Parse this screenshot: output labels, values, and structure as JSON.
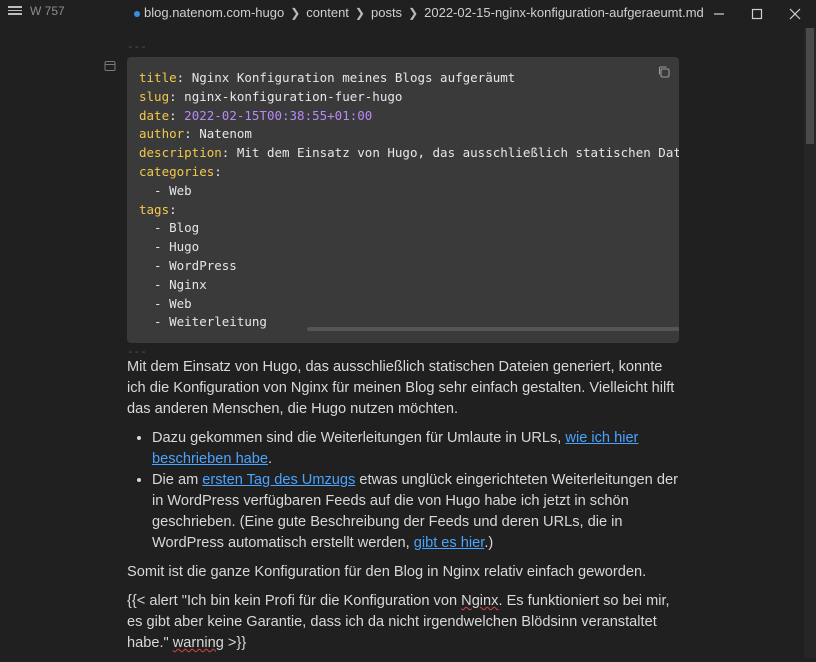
{
  "titlebar": {
    "word_count": "W 757",
    "breadcrumbs": [
      "blog.natenom.com-hugo",
      "content",
      "posts",
      "2022-02-15-nginx-konfiguration-aufgeraeumt.md"
    ]
  },
  "frontmatter": {
    "separator": "---",
    "lines": [
      {
        "key": "title",
        "value": " Nginx Konfiguration meines Blogs aufgeräumt"
      },
      {
        "key": "slug",
        "value": " nginx-konfiguration-fuer-hugo"
      },
      {
        "key": "date",
        "value": "2022-02-15T00:38:55+01:00"
      },
      {
        "key": "author",
        "value": " Natenom"
      },
      {
        "key": "description",
        "value": " Mit dem Einsatz von Hugo, das ausschließlich statischen Datei"
      },
      {
        "key": "categories",
        "value": ""
      },
      {
        "text": "  - Web"
      },
      {
        "key": "tags",
        "value": ""
      },
      {
        "text": "  - Blog"
      },
      {
        "text": "  - Hugo"
      },
      {
        "text": "  - WordPress"
      },
      {
        "text": "  - Nginx"
      },
      {
        "text": "  - Web"
      },
      {
        "text": "  - Weiterleitung"
      }
    ]
  },
  "body": {
    "intro": "Mit dem Einsatz von Hugo, das ausschließlich statischen Dateien generiert, konnte ich die Konfiguration von Nginx für meinen Blog sehr einfach gestalten. Vielleicht hilft das anderen Menschen, die Hugo nutzen möchten.",
    "bullet1_pre": "Dazu gekommen sind die Weiterleitungen für Umlaute in URLs, ",
    "bullet1_link": "wie ich hier beschrieben habe",
    "bullet1_post": ".",
    "bullet2_pre": "Die am ",
    "bullet2_link1": "ersten Tag des Umzugs",
    "bullet2_mid": " etwas unglück eingerichteten Weiterleitungen der in WordPress verfügbaren Feeds auf die von Hugo habe ich jetzt in schön geschrieben. (Eine gute Beschreibung der Feeds und deren URLs, die in WordPress automatisch erstellt werden, ",
    "bullet2_link2": "gibt es hier",
    "bullet2_post": ".)",
    "summary": "Somit ist die ganze Konfiguration für den Blog in Nginx relativ einfach geworden.",
    "alert_pre": "{{< alert \"Ich bin kein Profi für die Konfiguration von ",
    "alert_word1": "Nginx",
    "alert_mid": ". Es funktioniert so bei mir, es gibt aber keine Garantie, dass ich da nicht irgendwelchen Blödsinn veranstaltet habe.\" ",
    "alert_word2": "warning",
    "alert_post": " >}}"
  }
}
